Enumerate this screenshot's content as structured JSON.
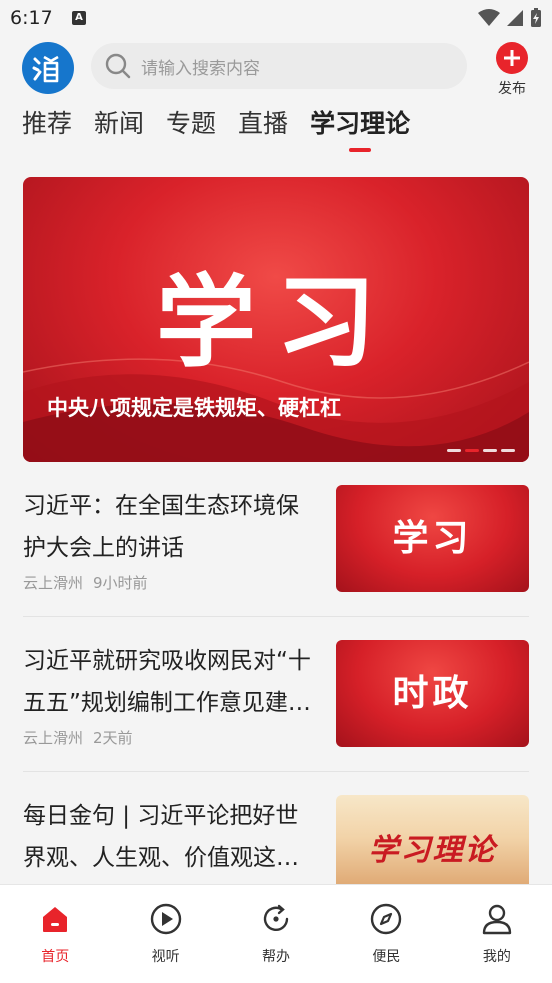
{
  "status": {
    "time": "6:17",
    "notif_icon": "A"
  },
  "header": {
    "logo_icon": "hua-logo-icon",
    "search_placeholder": "请输入搜索内容",
    "publish_label": "发布"
  },
  "tabs": [
    {
      "label": "推荐",
      "active": false
    },
    {
      "label": "新闻",
      "active": false
    },
    {
      "label": "专题",
      "active": false
    },
    {
      "label": "直播",
      "active": false
    },
    {
      "label": "学习理论",
      "active": true
    }
  ],
  "banner": {
    "big_text": "学习",
    "caption": "中央八项规定是铁规矩、硬杠杠",
    "pages": 4,
    "current_page": 2
  },
  "news": [
    {
      "title": "习近平：在全国生态环境保护大会上的讲话",
      "source": "云上滑州",
      "time": "9小时前",
      "thumb_text": "学习"
    },
    {
      "title": "习近平就研究吸收网民对“十五五”规划编制工作意见建议作出重要指示",
      "source": "云上滑州",
      "time": "2天前",
      "thumb_text": "时政"
    },
    {
      "title": "每日金句 | 习近平论把好世界观、人生观、价值观这个“总开关”",
      "source": "",
      "time": "",
      "thumb_text": "学习理论"
    }
  ],
  "bottom_nav": [
    {
      "label": "首页",
      "icon": "home-icon",
      "active": true
    },
    {
      "label": "视听",
      "icon": "play-icon",
      "active": false
    },
    {
      "label": "帮办",
      "icon": "refresh-icon",
      "active": false
    },
    {
      "label": "便民",
      "icon": "compass-icon",
      "active": false
    },
    {
      "label": "我的",
      "icon": "user-icon",
      "active": false
    }
  ],
  "colors": {
    "accent": "#e8242b",
    "logo_blue": "#1676cc"
  }
}
